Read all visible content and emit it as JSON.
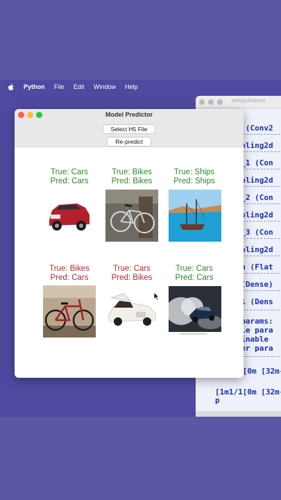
{
  "menubar": {
    "app": "Python",
    "items": [
      "File",
      "Edit",
      "Window",
      "Help"
    ]
  },
  "terminal": {
    "path": "sers/jyu/Docum",
    "lines": [
      "2d (Conv2",
      "pooling2d",
      "2d_1 (Con",
      "pooling2d",
      "2d_2 (Con",
      "pooling2d",
      "2d_3 (Con",
      "pooling2d",
      "ten (Flat",
      "e (Dense)",
      "e_1 (Dens",
      "l params:",
      "able para",
      "rainable",
      "izer para",
      "[1m1/1[0m [32m-",
      "[1m1/1[0m [32m-",
      "p"
    ]
  },
  "window": {
    "title": "Model Predictor",
    "select_button": "Select H5 File",
    "repredict_button": "Re-predict"
  },
  "predictions": [
    {
      "true_label": "True: Cars",
      "pred_label": "Pred: Cars",
      "correct": true,
      "image": "red-suv"
    },
    {
      "true_label": "True: Bikes",
      "pred_label": "Pred: Bikes",
      "correct": true,
      "image": "grey-bike"
    },
    {
      "true_label": "True: Ships",
      "pred_label": "Pred: Ships",
      "correct": true,
      "image": "sailing-ship"
    },
    {
      "true_label": "True: Bikes",
      "pred_label": "Pred: Cars",
      "correct": false,
      "image": "red-road-bike"
    },
    {
      "true_label": "True: Cars",
      "pred_label": "Pred: Bikes",
      "correct": false,
      "image": "white-rolls-royce"
    },
    {
      "true_label": "True: Cars",
      "pred_label": "Pred: Cars",
      "correct": true,
      "image": "drifting-car"
    }
  ],
  "colors": {
    "correct": "#2a8a2a",
    "incorrect": "#b22b2b",
    "wallpaper": "#5a55a5"
  }
}
